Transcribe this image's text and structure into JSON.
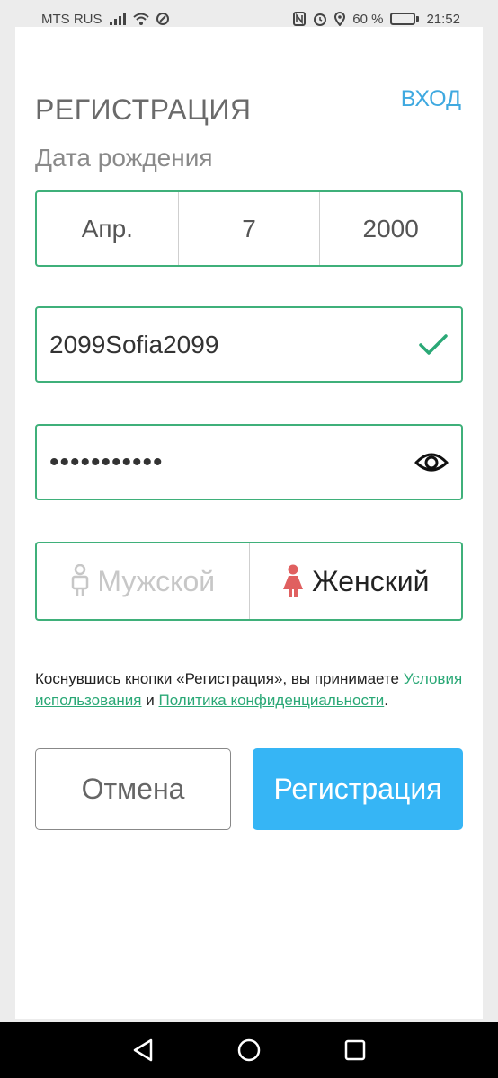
{
  "status_bar": {
    "carrier": "MTS RUS",
    "battery_percent": "60 %",
    "battery_level": 0.6,
    "time": "21:52"
  },
  "header": {
    "title": "РЕГИСТРАЦИЯ",
    "login_link": "ВХОД"
  },
  "birth_date": {
    "label": "Дата рождения",
    "month": "Апр.",
    "day": "7",
    "year": "2000"
  },
  "username": {
    "value": "2099Sofia2099",
    "valid": true
  },
  "password": {
    "value": "•••••••••••"
  },
  "gender": {
    "male_label": "Мужской",
    "female_label": "Женский",
    "selected": "female",
    "colors": {
      "female_icon": "#e06060",
      "male_icon": "#c7c7c7"
    }
  },
  "terms": {
    "prefix": "Коснувшись кнопки «Регистрация», вы принимаете ",
    "terms_link": "Условия использования",
    "conjunction": " и ",
    "privacy_link": "Политика конфиденциальности",
    "suffix": "."
  },
  "actions": {
    "cancel_label": "Отмена",
    "register_label": "Регистрация"
  },
  "colors": {
    "accent_green": "#3fb07a",
    "accent_blue": "#36b5f5",
    "link_blue": "#3fa9e0"
  },
  "icons": {
    "valid": "check-icon",
    "show_password": "eye-icon",
    "male": "male-person-icon",
    "female": "female-person-icon"
  }
}
